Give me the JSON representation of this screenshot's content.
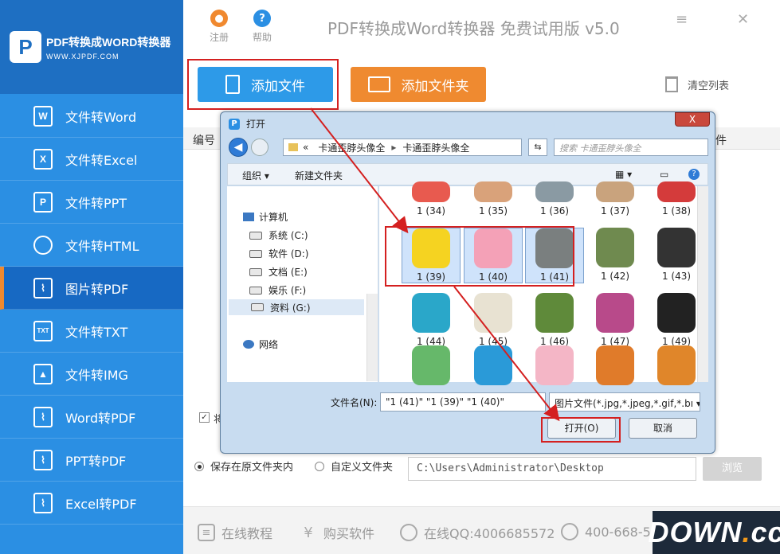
{
  "logo": {
    "mark": "P",
    "title": "PDF转换成WORD转换器",
    "url": "WWW.XJPDF.COM"
  },
  "app_title": "PDF转换成Word转换器 免费试用版 v5.0",
  "top_buttons": {
    "register": "注册",
    "help": "帮助"
  },
  "sidebar": {
    "items": [
      {
        "icon": "W",
        "label": "文件转Word"
      },
      {
        "icon": "X",
        "label": "文件转Excel"
      },
      {
        "icon": "P",
        "label": "文件转PPT"
      },
      {
        "icon": "",
        "label": "文件转HTML"
      },
      {
        "icon": "",
        "label": "图片转PDF"
      },
      {
        "icon": "TXT",
        "label": "文件转TXT"
      },
      {
        "icon": "",
        "label": "文件转IMG"
      },
      {
        "icon": "",
        "label": "Word转PDF"
      },
      {
        "icon": "",
        "label": "PPT转PDF"
      },
      {
        "icon": "",
        "label": "Excel转PDF"
      }
    ]
  },
  "actions": {
    "add_file": "添加文件",
    "add_folder": "添加文件夹",
    "clear_list": "清空列表"
  },
  "table": {
    "col_index": "编号",
    "col_file_tail": "件"
  },
  "checkbox_label": "将",
  "save": {
    "original_folder": "保存在原文件夹内",
    "custom_folder": "自定义文件夹",
    "path": "C:\\Users\\Administrator\\Desktop",
    "browse": "浏览"
  },
  "footer": {
    "tutorial": "在线教程",
    "buy": "购买软件",
    "qq": "在线QQ:4006685572",
    "phone": "400-668-55"
  },
  "watermark": {
    "down": "DOWN",
    "dot": ".",
    "cc": "cc"
  },
  "dialog": {
    "title": "打开",
    "close": "X",
    "address": {
      "prefix": "«",
      "part1": "卡通歪脖头像全",
      "sep": "▸",
      "part2": "卡通歪脖头像全"
    },
    "search_placeholder": "搜索 卡通歪脖头像全",
    "toolbar": {
      "organize": "组织 ▾",
      "new_folder": "新建文件夹"
    },
    "tree": [
      {
        "label": "计算机"
      },
      {
        "label": "系统 (C:)"
      },
      {
        "label": "软件 (D:)"
      },
      {
        "label": "文档 (E:)"
      },
      {
        "label": "娱乐 (F:)"
      },
      {
        "label": "资料 (G:)"
      },
      {
        "label": "网络"
      }
    ],
    "thumbs": [
      {
        "label": "1 (34)",
        "color": "#e85a4f"
      },
      {
        "label": "1 (35)",
        "color": "#d9a27a"
      },
      {
        "label": "1 (36)",
        "color": "#8a9aa3"
      },
      {
        "label": "1 (37)",
        "color": "#c9a37d"
      },
      {
        "label": "1 (38)",
        "color": "#d43b3b"
      },
      {
        "label": "1 (39)",
        "color": "#f5d321"
      },
      {
        "label": "1 (40)",
        "color": "#f4a1b7"
      },
      {
        "label": "1 (41)",
        "color": "#7a7f7f"
      },
      {
        "label": "1 (42)",
        "color": "#6f8a4f"
      },
      {
        "label": "1 (43)",
        "color": "#333333"
      },
      {
        "label": "1 (44)",
        "color": "#2aa7c9"
      },
      {
        "label": "1 (45)",
        "color": "#e8e2d2"
      },
      {
        "label": "1 (46)",
        "color": "#5f8a3a"
      },
      {
        "label": "1 (47)",
        "color": "#b84a8a"
      },
      {
        "label": "1 (49)",
        "color": "#222222"
      },
      {
        "label": "",
        "color": "#66b86a"
      },
      {
        "label": "",
        "color": "#2a9ad8"
      },
      {
        "label": "",
        "color": "#f4b6c6"
      },
      {
        "label": "",
        "color": "#e07b2a"
      },
      {
        "label": "",
        "color": "#e0862a"
      }
    ],
    "filename_label": "文件名(N):",
    "filename_value": "\"1 (41)\" \"1 (39)\" \"1 (40)\"",
    "filter": "图片文件(*.jpg,*.jpeg,*.gif,*.bı ▾",
    "open": "打开(O)",
    "cancel": "取消"
  }
}
